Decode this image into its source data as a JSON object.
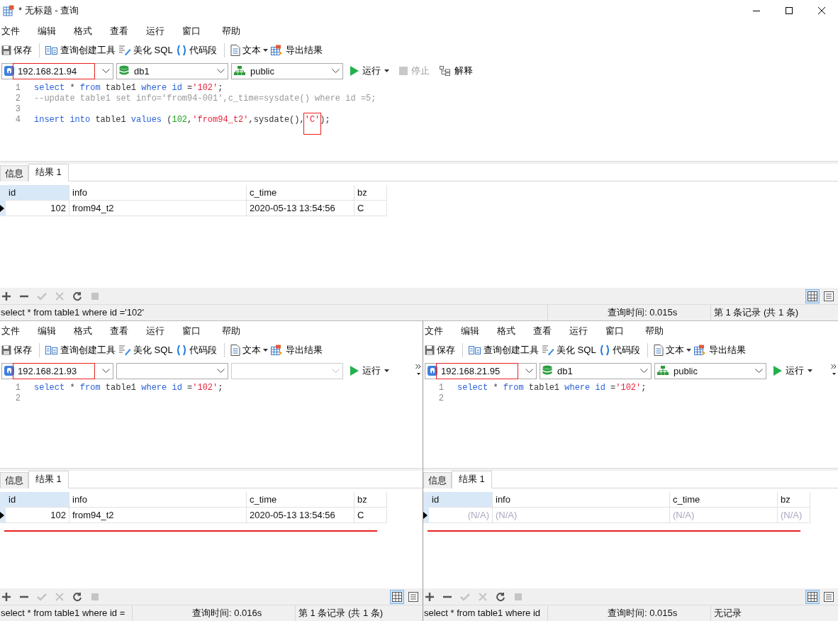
{
  "window": {
    "title": "* 无标题 - 查询"
  },
  "panes": [
    {
      "menu": [
        "文件",
        "编辑",
        "格式",
        "查看",
        "运行",
        "窗口",
        "帮助"
      ],
      "toolbar": [
        {
          "kind": "save",
          "label": "保存"
        },
        {
          "kind": "builder",
          "label": "查询创建工具"
        },
        {
          "kind": "beautify",
          "label": "美化 SQL"
        },
        {
          "kind": "snippet",
          "label": "代码段"
        },
        {
          "kind": "text",
          "label": "文本"
        },
        {
          "kind": "export",
          "label": "导出结果"
        }
      ],
      "connection": {
        "value": "192.168.21.94",
        "highlighted": true
      },
      "database": {
        "value": "db1",
        "enabled": true
      },
      "schema": {
        "value": "public",
        "enabled": true
      },
      "actions": [
        {
          "kind": "run",
          "label": "运行",
          "disabled": false
        },
        {
          "kind": "stop",
          "label": "停止",
          "disabled": true
        },
        {
          "kind": "explain",
          "label": "解释",
          "disabled": false
        }
      ],
      "editor": {
        "lines": [
          {
            "number": "1",
            "tokens": [
              {
                "kind": "keyword",
                "text": "select"
              },
              {
                "kind": "plain",
                "text": " * "
              },
              {
                "kind": "keyword",
                "text": "from"
              },
              {
                "kind": "plain",
                "text": " table1 "
              },
              {
                "kind": "keyword",
                "text": "where id"
              },
              {
                "kind": "plain",
                "text": " ="
              },
              {
                "kind": "string",
                "text": "'102'"
              },
              {
                "kind": "plain",
                "text": ";"
              }
            ]
          },
          {
            "number": "2",
            "tokens": [
              {
                "kind": "comment",
                "text": "--update table1 set info='from94-001',c_time=sysdate() where id =5;"
              }
            ]
          },
          {
            "number": "3"
          },
          {
            "number": "4",
            "tokens": [
              {
                "kind": "keyword",
                "text": "insert into"
              },
              {
                "kind": "plain",
                "text": " table1 "
              },
              {
                "kind": "keyword",
                "text": "values"
              },
              {
                "kind": "plain",
                "text": " ("
              },
              {
                "kind": "number",
                "text": "102"
              },
              {
                "kind": "plain",
                "text": ","
              },
              {
                "kind": "string",
                "text": "'from94_t2'"
              },
              {
                "kind": "plain",
                "text": ",sysdate(),"
              },
              {
                "kind": "string",
                "text": "'C'",
                "boxed": true
              },
              {
                "kind": "plain",
                "text": ");"
              }
            ]
          }
        ]
      },
      "tabs": [
        {
          "label": "信息",
          "selected": false
        },
        {
          "label": "结果 1",
          "selected": true
        }
      ],
      "grid": {
        "columns": [
          {
            "name": "id",
            "numeric": true,
            "selected": true
          },
          {
            "name": "info",
            "numeric": false,
            "selected": false
          },
          {
            "name": "c_time",
            "numeric": false,
            "selected": false
          },
          {
            "name": "bz",
            "numeric": false,
            "selected": false
          }
        ],
        "rows": [
          {
            "current": true,
            "cells": [
              {
                "text": "102",
                "null": false
              },
              {
                "text": "from94_t2",
                "null": false
              },
              {
                "text": "2020-05-13 13:54:56",
                "null": false
              },
              {
                "text": "C",
                "null": false
              }
            ]
          }
        ]
      },
      "grid_tools": [
        {
          "kind": "add",
          "disabled": false
        },
        {
          "kind": "remove",
          "disabled": false
        },
        {
          "kind": "apply",
          "disabled": true
        },
        {
          "kind": "cancel",
          "disabled": true
        },
        {
          "kind": "refresh",
          "disabled": false
        },
        {
          "kind": "stop",
          "disabled": true
        }
      ],
      "view_modes": [
        {
          "kind": "grid",
          "selected": true
        },
        {
          "kind": "form",
          "selected": false
        }
      ],
      "status_bar": {
        "sql": "select * from table1 where id ='102'",
        "time": "查询时间: 0.015s",
        "records": "第 1 条记录 (共 1 条)"
      }
    },
    {
      "menu": [
        "文件",
        "编辑",
        "格式",
        "查看",
        "运行",
        "窗口",
        "帮助"
      ],
      "toolbar": [
        {
          "kind": "save",
          "label": "保存"
        },
        {
          "kind": "builder",
          "label": "查询创建工具"
        },
        {
          "kind": "beautify",
          "label": "美化 SQL"
        },
        {
          "kind": "snippet",
          "label": "代码段"
        },
        {
          "kind": "text",
          "label": "文本"
        },
        {
          "kind": "export",
          "label": "导出结果"
        }
      ],
      "connection": {
        "value": "192.168.21.93",
        "highlighted": true
      },
      "database": {
        "enabled": true
      },
      "schema": {
        "enabled": false
      },
      "actions": [
        {
          "kind": "run",
          "label": "运行",
          "disabled": false
        }
      ],
      "overflow": true,
      "editor": {
        "lines": [
          {
            "number": "1",
            "tokens": [
              {
                "kind": "keyword",
                "text": "select"
              },
              {
                "kind": "plain",
                "text": " * "
              },
              {
                "kind": "keyword",
                "text": "from"
              },
              {
                "kind": "plain",
                "text": " table1 "
              },
              {
                "kind": "keyword",
                "text": "where id"
              },
              {
                "kind": "plain",
                "text": " ="
              },
              {
                "kind": "string",
                "text": "'102'"
              },
              {
                "kind": "plain",
                "text": ";"
              }
            ]
          },
          {
            "number": "2"
          }
        ]
      },
      "tabs": [
        {
          "label": "信息",
          "selected": false
        },
        {
          "label": "结果 1",
          "selected": true
        }
      ],
      "grid": {
        "columns": [
          {
            "name": "id",
            "numeric": true,
            "selected": true
          },
          {
            "name": "info",
            "numeric": false,
            "selected": false
          },
          {
            "name": "c_time",
            "numeric": false,
            "selected": false
          },
          {
            "name": "bz",
            "numeric": false,
            "selected": false
          }
        ],
        "rows": [
          {
            "current": true,
            "cells": [
              {
                "text": "102",
                "null": false
              },
              {
                "text": "from94_t2",
                "null": false
              },
              {
                "text": "2020-05-13 13:54:56",
                "null": false
              },
              {
                "text": "C",
                "null": false
              }
            ]
          }
        ],
        "underlined": true
      },
      "grid_tools": [
        {
          "kind": "add",
          "disabled": false
        },
        {
          "kind": "remove",
          "disabled": false
        },
        {
          "kind": "apply",
          "disabled": true
        },
        {
          "kind": "cancel",
          "disabled": true
        },
        {
          "kind": "refresh",
          "disabled": false
        },
        {
          "kind": "stop",
          "disabled": true
        }
      ],
      "view_modes": [
        {
          "kind": "grid",
          "selected": true
        },
        {
          "kind": "form",
          "selected": false
        }
      ],
      "status_bar": {
        "sql": "select * from table1 where id =",
        "time": "查询时间: 0.016s",
        "records": "第 1 条记录 (共 1 条)"
      }
    },
    {
      "menu": [
        "文件",
        "编辑",
        "格式",
        "查看",
        "运行",
        "窗口",
        "帮助"
      ],
      "toolbar": [
        {
          "kind": "save",
          "label": "保存"
        },
        {
          "kind": "builder",
          "label": "查询创建工具"
        },
        {
          "kind": "beautify",
          "label": "美化 SQL"
        },
        {
          "kind": "snippet",
          "label": "代码段"
        },
        {
          "kind": "text",
          "label": "文本"
        },
        {
          "kind": "export",
          "label": "导出结果"
        }
      ],
      "connection": {
        "value": "192.168.21.95",
        "highlighted": true
      },
      "database": {
        "value": "db1",
        "enabled": true
      },
      "schema": {
        "value": "public",
        "enabled": true
      },
      "actions": [
        {
          "kind": "run",
          "label": "运行",
          "disabled": false
        }
      ],
      "overflow": true,
      "editor": {
        "lines": [
          {
            "number": "1",
            "tokens": [
              {
                "kind": "keyword",
                "text": "select"
              },
              {
                "kind": "plain",
                "text": " * "
              },
              {
                "kind": "keyword",
                "text": "from"
              },
              {
                "kind": "plain",
                "text": " table1 "
              },
              {
                "kind": "keyword",
                "text": "where id"
              },
              {
                "kind": "plain",
                "text": " ="
              },
              {
                "kind": "string",
                "text": "'102'"
              },
              {
                "kind": "plain",
                "text": ";"
              }
            ]
          },
          {
            "number": "2"
          }
        ]
      },
      "tabs": [
        {
          "label": "信息",
          "selected": false
        },
        {
          "label": "结果 1",
          "selected": true
        }
      ],
      "grid": {
        "columns": [
          {
            "name": "id",
            "numeric": true,
            "selected": true
          },
          {
            "name": "info",
            "numeric": false,
            "selected": false
          },
          {
            "name": "c_time",
            "numeric": false,
            "selected": false
          },
          {
            "name": "bz",
            "numeric": false,
            "selected": false
          }
        ],
        "rows": [
          {
            "current": true,
            "cells": [
              {
                "text": "(N/A)",
                "null": true
              },
              {
                "text": "(N/A)",
                "null": true
              },
              {
                "text": "(N/A)",
                "null": true
              },
              {
                "text": "(N/A)",
                "null": true
              }
            ]
          }
        ],
        "underlined": true
      },
      "grid_tools": [
        {
          "kind": "add",
          "disabled": false
        },
        {
          "kind": "remove",
          "disabled": false
        },
        {
          "kind": "apply",
          "disabled": true
        },
        {
          "kind": "cancel",
          "disabled": true
        },
        {
          "kind": "refresh",
          "disabled": false
        },
        {
          "kind": "stop",
          "disabled": true
        }
      ],
      "view_modes": [
        {
          "kind": "grid",
          "selected": true
        },
        {
          "kind": "form",
          "selected": false
        }
      ],
      "status_bar": {
        "sql": "select * from table1 where id",
        "time": "查询时间: 0.015s",
        "records": "无记录"
      }
    }
  ]
}
